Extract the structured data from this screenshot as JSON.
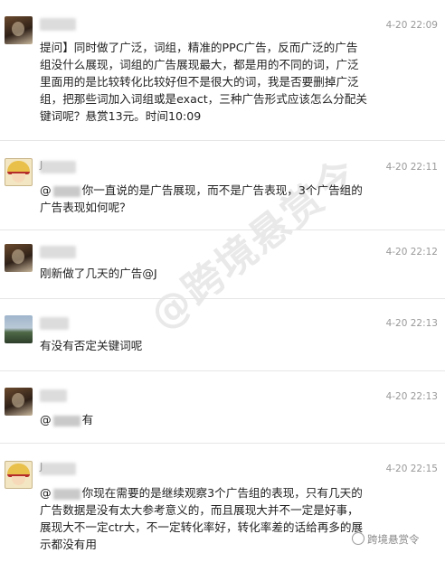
{
  "messages": [
    {
      "time": "4-20 22:09",
      "lines": [
        "提问】同时做了广泛，词组，精准的PPC广告，反而广泛的广告",
        "组没什么展现，词组的广告展现最大，都是用的不同的词，广泛",
        "里面用的是比较转化比较好但不是很大的词，我是否要删掉广泛",
        "组，把那些词加入词组或是exact，三种广告形式应该怎么分配关",
        "键词呢？悬赏13元。时间10:09"
      ]
    },
    {
      "time": "4-20 22:11",
      "name_initial": "J",
      "line1_prefix": "@",
      "line1_rest": "你一直说的是广告展现，而不是广告表现，3个广告组的",
      "line2": "广告表现如何呢？"
    },
    {
      "time": "4-20 22:12",
      "line": "刚新做了几天的广告@J"
    },
    {
      "time": "4-20 22:13",
      "line": "有没有否定关键词呢"
    },
    {
      "time": "4-20 22:13",
      "line_prefix": "@",
      "line_suffix": "有"
    },
    {
      "time": "4-20 22:15",
      "name_initial": "J",
      "line1_prefix": "@",
      "line1_rest": "你现在需要的是继续观察3个广告组的表现，只有几天的",
      "lines_rest": [
        "广告数据是没有太大参考意义的，而且展现大并不一定是好事，",
        "展现大不一定ctr大，不一定转化率好，转化率差的话给再多的展",
        "示都没有用"
      ]
    }
  ],
  "watermark": {
    "main": "@跨境悬赏令",
    "corner": "跨境悬赏令"
  }
}
